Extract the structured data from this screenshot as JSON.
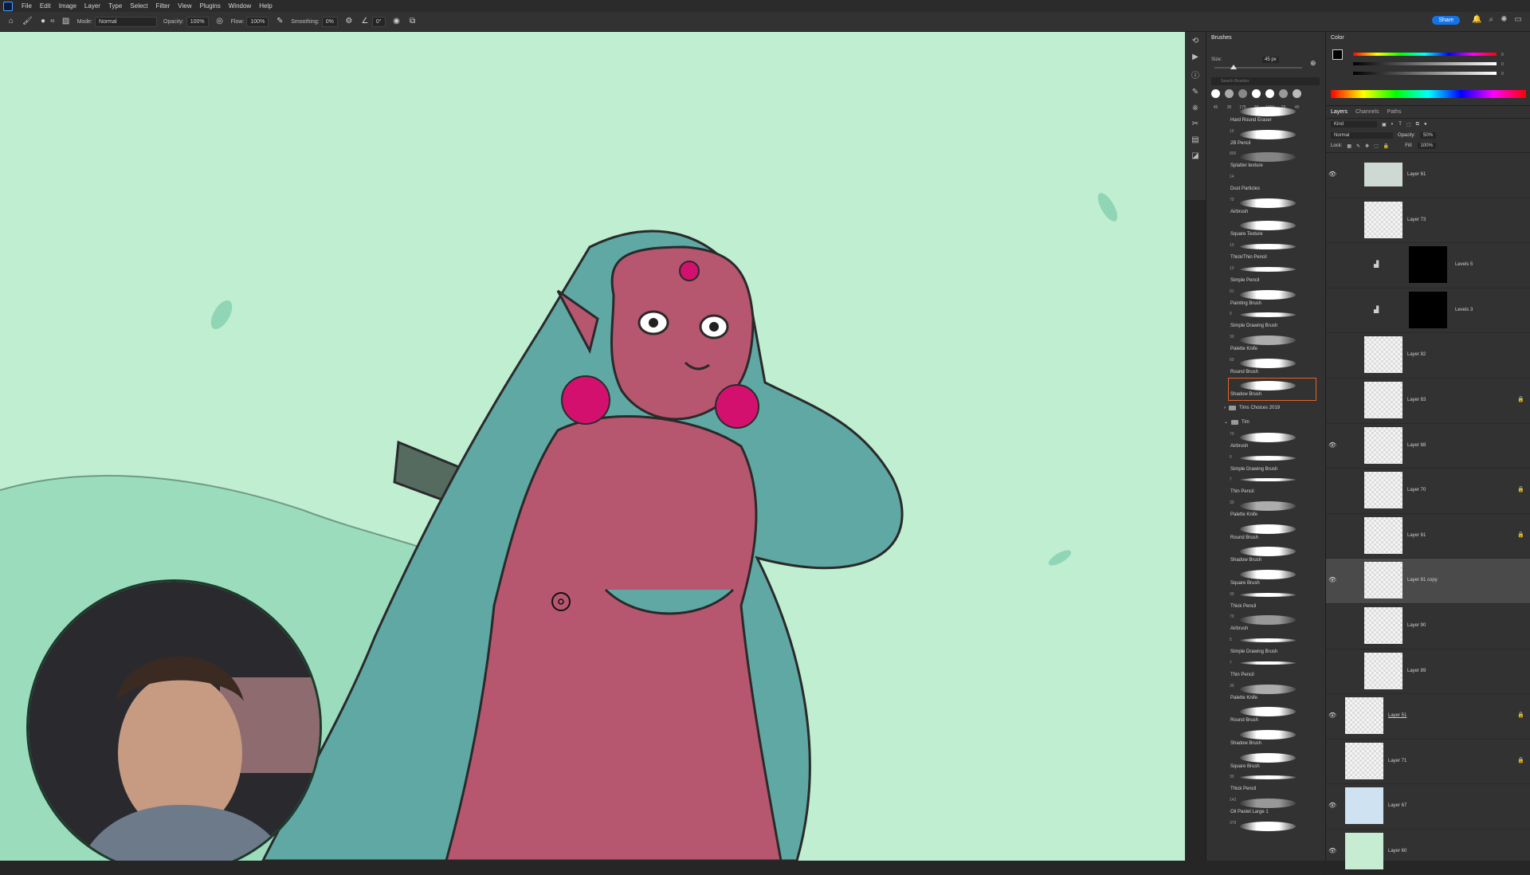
{
  "menu": {
    "items": [
      "File",
      "Edit",
      "Image",
      "Layer",
      "Type",
      "Select",
      "Filter",
      "View",
      "Plugins",
      "Window",
      "Help"
    ]
  },
  "options": {
    "mode_label": "Mode:",
    "mode_value": "Normal",
    "opacity_label": "Opacity:",
    "opacity_value": "100%",
    "flow_label": "Flow:",
    "flow_value": "100%",
    "smoothing_label": "Smoothing:",
    "smoothing_value": "0%",
    "angle_value": "0°",
    "brush_size": "45"
  },
  "share_label": "Share",
  "brushes": {
    "tab": "Brushes",
    "size_label": "Size:",
    "size_value": "45 px",
    "search_placeholder": "Search Brushes",
    "presets": [
      "45",
      "35",
      "175",
      "20",
      "1300",
      "25",
      "40"
    ],
    "list": [
      {
        "size": "",
        "name": "Hard Round Eraser"
      },
      {
        "size": "15",
        "name": "2B Pencil"
      },
      {
        "size": "800",
        "name": "Splatter texture"
      },
      {
        "size": "14",
        "name": "Dust Particles"
      },
      {
        "size": "70",
        "name": "Airbrush"
      },
      {
        "size": "",
        "name": "Square Texture"
      },
      {
        "size": "10",
        "name": "Thick/Thin Pencil"
      },
      {
        "size": "10",
        "name": "Simple Pencil"
      },
      {
        "size": "91",
        "name": "Painting Brush"
      },
      {
        "size": "5",
        "name": "Simple Drawing Brush"
      },
      {
        "size": "30",
        "name": "Palette Knife"
      },
      {
        "size": "60",
        "name": "Round Brush"
      },
      {
        "size": "",
        "name": "Shadow Brush"
      }
    ],
    "groups": [
      "Tims Choices 2019",
      "Tim"
    ],
    "tim_list": [
      {
        "size": "70",
        "name": "Airbrush"
      },
      {
        "size": "5",
        "name": "Simple Drawing Brush"
      },
      {
        "size": "7",
        "name": "Thin Pencil"
      },
      {
        "size": "30",
        "name": "Palette Knife"
      },
      {
        "size": "",
        "name": "Round Brush"
      },
      {
        "size": "",
        "name": "Shadow Brush"
      },
      {
        "size": "",
        "name": "Square Brush"
      },
      {
        "size": "30",
        "name": "Thick Pencil"
      },
      {
        "size": "70",
        "name": "Airbrush"
      },
      {
        "size": "5",
        "name": "Simple Drawing Brush"
      },
      {
        "size": "7",
        "name": "Thin Pencil"
      },
      {
        "size": "30",
        "name": "Palette Knife"
      },
      {
        "size": "",
        "name": "Round Brush"
      },
      {
        "size": "",
        "name": "Shadow Brush"
      },
      {
        "size": "",
        "name": "Square Brush"
      },
      {
        "size": "30",
        "name": "Thick Pencil"
      },
      {
        "size": "143",
        "name": "Oil Pastel Large 1"
      },
      {
        "size": "379",
        "name": ""
      }
    ]
  },
  "color": {
    "tab": "Color",
    "fg": "#000000",
    "bg": "#ffffff",
    "values": [
      "0",
      "0",
      "0"
    ]
  },
  "layers_panel": {
    "tabs": [
      "Layers",
      "Channels",
      "Paths"
    ],
    "kind_label": "Kind",
    "blend_mode": "Normal",
    "opacity_label": "Opacity:",
    "opacity_value": "50%",
    "lock_label": "Lock:",
    "fill_label": "Fill:",
    "fill_value": "100%",
    "layers": [
      {
        "name": "Layer 61",
        "visible": true
      },
      {
        "name": "Layer 73",
        "visible": false
      },
      {
        "name": "Levels 5",
        "visible": false
      },
      {
        "name": "Levels 3",
        "visible": false
      },
      {
        "name": "Layer 82",
        "visible": false
      },
      {
        "name": "Layer 83",
        "visible": false
      },
      {
        "name": "Layer 88",
        "visible": true
      },
      {
        "name": "Layer 70",
        "visible": false
      },
      {
        "name": "Layer 81",
        "visible": false
      },
      {
        "name": "Layer 81 copy",
        "visible": true
      },
      {
        "name": "Layer 90",
        "visible": false
      },
      {
        "name": "Layer 89",
        "visible": false
      },
      {
        "name": "Layer 51",
        "visible": true
      },
      {
        "name": "Layer 71",
        "visible": false
      },
      {
        "name": "Layer 67",
        "visible": true
      },
      {
        "name": "Layer 60",
        "visible": true
      }
    ]
  }
}
